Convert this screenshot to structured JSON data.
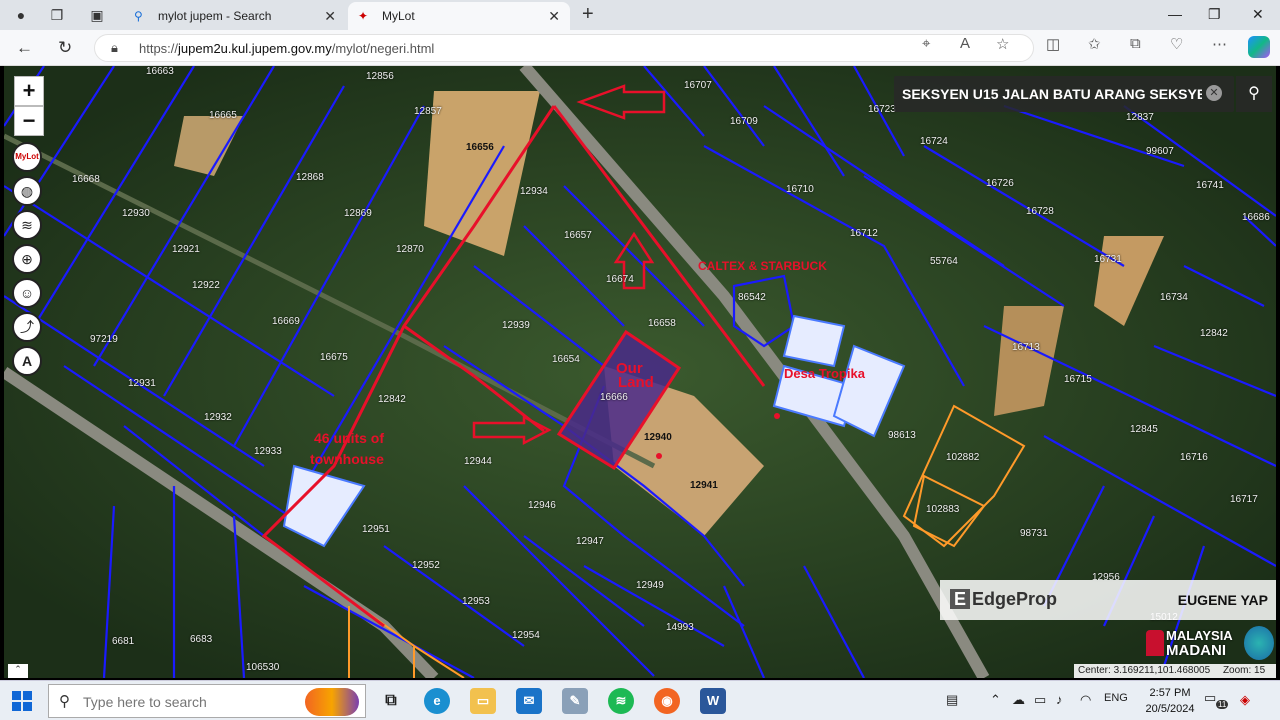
{
  "browser": {
    "tabs": [
      {
        "title": "mylot jupem - Search",
        "icon": "search-icon"
      },
      {
        "title": "MyLot",
        "icon": "mylot-favicon"
      }
    ],
    "url_prefix": "https://",
    "url_domain": "jupem2u.kul.jupem.gov.my",
    "url_path": "/mylot/negeri.html"
  },
  "map": {
    "search_value": "SEKSYEN U15 JALAN BATU ARANG SEKSYEN U",
    "zoom_in": "+",
    "zoom_out": "−",
    "tools": [
      "MyLot",
      "globe-icon",
      "layers-icon",
      "locate-icon",
      "measure-icon",
      "route-icon",
      "text-icon"
    ],
    "parcels": [
      {
        "label": "16663"
      },
      {
        "label": "12856"
      },
      {
        "label": "16707"
      },
      {
        "label": "16665"
      },
      {
        "label": "12857"
      },
      {
        "label": "16656"
      },
      {
        "label": "16709"
      },
      {
        "label": "16723"
      },
      {
        "label": "12837"
      },
      {
        "label": "16668"
      },
      {
        "label": "12868"
      },
      {
        "label": "12934"
      },
      {
        "label": "16724"
      },
      {
        "label": "99607"
      },
      {
        "label": "12930"
      },
      {
        "label": "12869"
      },
      {
        "label": "16710"
      },
      {
        "label": "16726"
      },
      {
        "label": "16741"
      },
      {
        "label": "12921"
      },
      {
        "label": "12870"
      },
      {
        "label": "16657"
      },
      {
        "label": "16712"
      },
      {
        "label": "16728"
      },
      {
        "label": "16686"
      },
      {
        "label": "12922"
      },
      {
        "label": "16674"
      },
      {
        "label": "55764"
      },
      {
        "label": "16731"
      },
      {
        "label": "86542"
      },
      {
        "label": "16734"
      },
      {
        "label": "16669"
      },
      {
        "label": "12939"
      },
      {
        "label": "16658"
      },
      {
        "label": "97219"
      },
      {
        "label": "12842"
      },
      {
        "label": "16675"
      },
      {
        "label": "16654"
      },
      {
        "label": "16713"
      },
      {
        "label": "12931"
      },
      {
        "label": "16715"
      },
      {
        "label": "12842"
      },
      {
        "label": "16666"
      },
      {
        "label": "12932"
      },
      {
        "label": "12940"
      },
      {
        "label": "98613"
      },
      {
        "label": "12845"
      },
      {
        "label": "12933"
      },
      {
        "label": "12944"
      },
      {
        "label": "102882"
      },
      {
        "label": "16716"
      },
      {
        "label": "12941"
      },
      {
        "label": "16717"
      },
      {
        "label": "102883"
      },
      {
        "label": "12946"
      },
      {
        "label": "12951"
      },
      {
        "label": "12947"
      },
      {
        "label": "98731"
      },
      {
        "label": "12952"
      },
      {
        "label": "12956"
      },
      {
        "label": "12949"
      },
      {
        "label": "12953"
      },
      {
        "label": "14993"
      },
      {
        "label": "15012"
      },
      {
        "label": "12954"
      },
      {
        "label": "6681"
      },
      {
        "label": "6683"
      },
      {
        "label": "106530"
      }
    ],
    "annotations": {
      "caltex": "CALTEX & STARBUCK",
      "desa": "Desa Tropika",
      "our_land_1": "Our",
      "our_land_2": "Land",
      "units_1": "46 units of",
      "units_2": "townhouse"
    },
    "watermark": {
      "logo": "EdgeProp",
      "agent": "EUGENE YAP"
    },
    "madani": {
      "line1": "MALAYSIA",
      "line2": "MADANI"
    },
    "center": "Center: 3.169211,101.468005",
    "zoom": "Zoom: 15",
    "colors": {
      "boundary": "#1a1aff",
      "annotation": "#e8102a",
      "highlight": "#ff9a2a",
      "our_land_fill": "#4a2a8a"
    }
  },
  "taskbar": {
    "search_placeholder": "Type here to search",
    "lang": "ENG",
    "time": "2:57 PM",
    "date": "20/5/2024",
    "notif_count": "11"
  }
}
